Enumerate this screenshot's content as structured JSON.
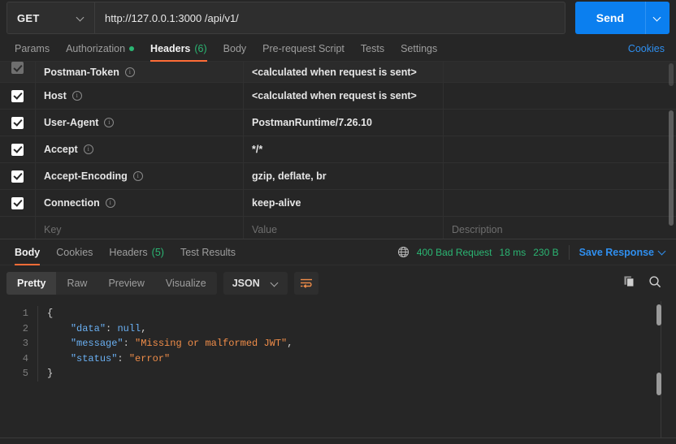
{
  "request": {
    "method": "GET",
    "method_caret": "chevron-down-icon",
    "url": "http://127.0.0.1:3000 /api/v1/",
    "url_placeholder": "Enter request URL",
    "send_label": "Send",
    "send_caret": "chevron-down-icon"
  },
  "request_tabs": {
    "items": [
      {
        "label": "Params",
        "active": false,
        "badge": ""
      },
      {
        "label": "Authorization",
        "active": false,
        "badge": "",
        "dot": true
      },
      {
        "label": "Headers",
        "active": true,
        "badge": "(6)"
      },
      {
        "label": "Body",
        "active": false,
        "badge": ""
      },
      {
        "label": "Pre-request Script",
        "active": false,
        "badge": ""
      },
      {
        "label": "Tests",
        "active": false,
        "badge": ""
      },
      {
        "label": "Settings",
        "active": false,
        "badge": ""
      }
    ],
    "cookies_link": "Cookies"
  },
  "headers_table": {
    "columns": {
      "key": "Key",
      "value": "Value",
      "description": "Description"
    },
    "rows": [
      {
        "checked": true,
        "muted": true,
        "key": "Postman-Token",
        "value": "<calculated when request is sent>",
        "description": ""
      },
      {
        "checked": true,
        "muted": false,
        "key": "Host",
        "value": "<calculated when request is sent>",
        "description": ""
      },
      {
        "checked": true,
        "muted": false,
        "key": "User-Agent",
        "value": "PostmanRuntime/7.26.10",
        "description": ""
      },
      {
        "checked": true,
        "muted": false,
        "key": "Accept",
        "value": "*/*",
        "description": ""
      },
      {
        "checked": true,
        "muted": false,
        "key": "Accept-Encoding",
        "value": "gzip, deflate, br",
        "description": ""
      },
      {
        "checked": true,
        "muted": false,
        "key": "Connection",
        "value": "keep-alive",
        "description": ""
      }
    ],
    "placeholder_row": {
      "key": "Key",
      "value": "Value",
      "description": "Description"
    },
    "info_icon": "info-icon"
  },
  "response_tabs": {
    "items": [
      {
        "label": "Body",
        "active": true,
        "badge": ""
      },
      {
        "label": "Cookies",
        "active": false,
        "badge": ""
      },
      {
        "label": "Headers",
        "active": false,
        "badge": "(5)"
      },
      {
        "label": "Test Results",
        "active": false,
        "badge": ""
      }
    ],
    "globe_icon": "globe-icon",
    "status": "400 Bad Request",
    "time": "18 ms",
    "size": "230 B",
    "save_response": "Save Response",
    "save_caret": "chevron-down-icon"
  },
  "format_bar": {
    "views": [
      {
        "label": "Pretty",
        "active": true
      },
      {
        "label": "Raw",
        "active": false
      },
      {
        "label": "Preview",
        "active": false
      },
      {
        "label": "Visualize",
        "active": false
      }
    ],
    "language": "JSON",
    "language_caret": "chevron-down-icon",
    "wrap_icon": "word-wrap-icon",
    "copy_icon": "copy-icon",
    "search_icon": "search-icon"
  },
  "response_body": {
    "line_numbers": [
      "1",
      "2",
      "3",
      "4",
      "5"
    ],
    "lines": [
      {
        "tokens": [
          {
            "t": "{",
            "c": "b"
          }
        ]
      },
      {
        "tokens": [
          {
            "t": "    ",
            "c": "b"
          },
          {
            "t": "\"data\"",
            "c": "k"
          },
          {
            "t": ": ",
            "c": "p"
          },
          {
            "t": "null",
            "c": "n"
          },
          {
            "t": ",",
            "c": "p"
          }
        ]
      },
      {
        "tokens": [
          {
            "t": "    ",
            "c": "b"
          },
          {
            "t": "\"message\"",
            "c": "k"
          },
          {
            "t": ": ",
            "c": "p"
          },
          {
            "t": "\"Missing or malformed JWT\"",
            "c": "s"
          },
          {
            "t": ",",
            "c": "p"
          }
        ]
      },
      {
        "tokens": [
          {
            "t": "    ",
            "c": "b"
          },
          {
            "t": "\"status\"",
            "c": "k"
          },
          {
            "t": ": ",
            "c": "p"
          },
          {
            "t": "\"error\"",
            "c": "s"
          }
        ]
      },
      {
        "tokens": [
          {
            "t": "}",
            "c": "b"
          }
        ]
      }
    ]
  },
  "colors": {
    "accent_orange": "#ff6c37",
    "send_blue": "#0b7fef",
    "link_blue": "#2f8fef",
    "status_green": "#2bb673",
    "background": "#262626",
    "panel": "#2e2e2e",
    "border": "#303030",
    "json_key": "#6ab0f3",
    "json_string": "#f08d49"
  }
}
